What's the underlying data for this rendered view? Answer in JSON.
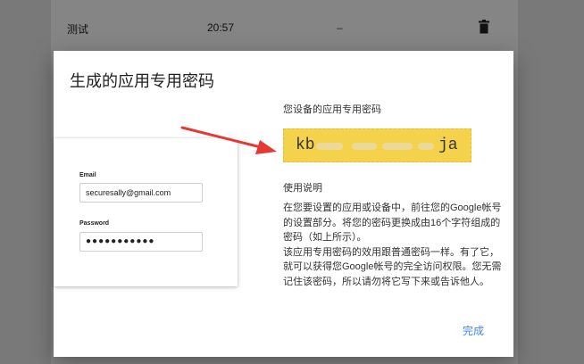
{
  "background": {
    "row": {
      "name": "测试",
      "time": "20:57",
      "dash": "–"
    }
  },
  "dialog": {
    "title": "生成的应用专用密码",
    "illustration": {
      "email_label": "Email",
      "email_value": "securesally@gmail.com",
      "password_label": "Password",
      "password_value": "●●●●●●●●●●●"
    },
    "password_heading": "您设备的应用专用密码",
    "password_visible_start": "kb",
    "password_visible_end": "ja",
    "usage_title": "使用说明",
    "usage_paragraph_1": "在您要设置的应用或设备中，前往您的Google帐号的设置部分。将您的密码更换成由16个字符组成的密码（如上所示）。",
    "usage_paragraph_2": "该应用专用密码的效用跟普通密码一样。有了它，就可以获得您Google帐号的完全访问权限。您无需记住该密码，所以请勿将它写下来或告诉他人。",
    "done_label": "完成"
  },
  "colors": {
    "accent": "#4285f4",
    "password_highlight": "#f5d24c",
    "arrow": "#e53935"
  }
}
